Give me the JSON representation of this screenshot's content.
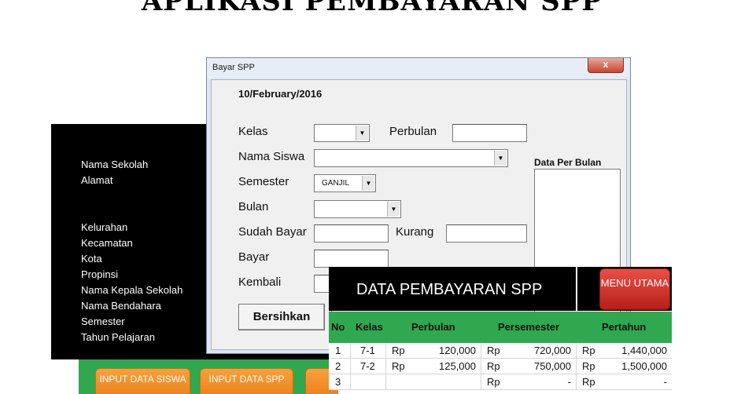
{
  "app": {
    "title": "APLIKASI PEMBAYARAN SPP"
  },
  "school_panel": {
    "labels": [
      "Nama Sekolah",
      "Alamat",
      "Kelurahan",
      "Kecamatan",
      "Kota",
      "Propinsi",
      "Nama Kepala Sekolah",
      "Nama Bendahara",
      "Semester",
      "Tahun Pelajaran"
    ]
  },
  "menu_buttons": [
    "INPUT DATA SISWA",
    "INPUT DATA SPP"
  ],
  "dialog": {
    "title": "Bayar SPP",
    "close": "x",
    "date": "10/February/2016",
    "labels": {
      "kelas": "Kelas",
      "perbulan": "Perbulan",
      "nama_siswa": "Nama Siswa",
      "semester": "Semester",
      "bulan": "Bulan",
      "sudah_bayar": "Sudah Bayar",
      "kurang": "Kurang",
      "bayar": "Bayar",
      "kembali": "Kembali"
    },
    "semester_value": "GANJIL",
    "side_label": "Data Per Bulan",
    "bersihkan": "Bersihkan"
  },
  "data_table": {
    "title": "DATA PEMBAYARAN SPP",
    "menu_button": "MENU UTAMA",
    "headers": [
      "No",
      "Kelas",
      "Perbulan",
      "Persemester",
      "Pertahun"
    ],
    "rows": [
      {
        "no": "1",
        "kelas": "7-1",
        "rp1": "Rp",
        "perbulan": "120,000",
        "rp2": "Rp",
        "persemester": "720,000",
        "rp3": "Rp",
        "pertahun": "1,440,000"
      },
      {
        "no": "2",
        "kelas": "7-2",
        "rp1": "Rp",
        "perbulan": "125,000",
        "rp2": "Rp",
        "persemester": "750,000",
        "rp3": "Rp",
        "pertahun": "1,500,000"
      },
      {
        "no": "3",
        "kelas": "",
        "rp1": "",
        "perbulan": "",
        "rp2": "Rp",
        "persemester": "-",
        "rp3": "Rp",
        "pertahun": "-"
      }
    ]
  }
}
